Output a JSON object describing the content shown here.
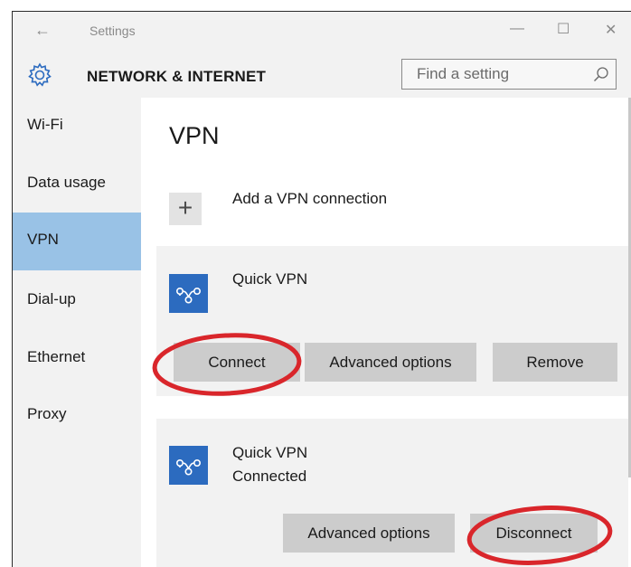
{
  "window": {
    "title": "Settings",
    "back_glyph": "←",
    "minimize_glyph": "—",
    "maximize_glyph": "☐",
    "close_glyph": "✕"
  },
  "header": {
    "title": "NETWORK & INTERNET",
    "icon": "gear-icon",
    "search": {
      "placeholder": "Find a setting",
      "value": "",
      "icon": "search-icon"
    }
  },
  "sidebar": {
    "items": [
      {
        "label": "Wi-Fi",
        "selected": false
      },
      {
        "label": "Data usage",
        "selected": false
      },
      {
        "label": "VPN",
        "selected": true
      },
      {
        "label": "Dial-up",
        "selected": false
      },
      {
        "label": "Ethernet",
        "selected": false
      },
      {
        "label": "Proxy",
        "selected": false
      }
    ],
    "selected_color": "#99c2e6"
  },
  "main": {
    "title": "VPN",
    "add_connection": {
      "label": "Add a VPN connection",
      "icon": "plus-icon",
      "glyph": "+"
    },
    "connections": [
      {
        "name": "Quick VPN",
        "status": "",
        "icon": "vpn-icon",
        "buttons": {
          "connect": "Connect",
          "advanced": "Advanced options",
          "remove": "Remove"
        }
      },
      {
        "name": "Quick VPN",
        "status": "Connected",
        "icon": "vpn-icon",
        "buttons": {
          "advanced": "Advanced options",
          "disconnect": "Disconnect"
        }
      }
    ]
  },
  "colors": {
    "accent": "#2c6bbf",
    "annotation": "#d9262b",
    "button": "#cccccc",
    "card": "#f2f2f2"
  }
}
